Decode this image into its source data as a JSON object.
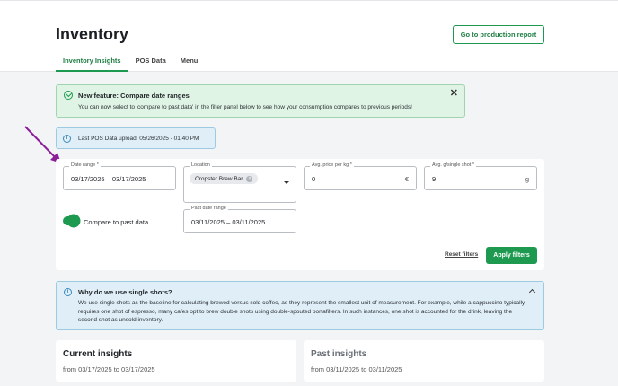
{
  "header": {
    "title": "Inventory",
    "production_report_label": "Go to production report",
    "tabs": [
      {
        "label": "Inventory Insights",
        "active": true
      },
      {
        "label": "POS Data",
        "active": false
      },
      {
        "label": "Menu",
        "active": false
      }
    ]
  },
  "banner": {
    "title": "New feature: Compare date ranges",
    "body": "You can now select to 'compare to past data' in the filter panel below to see how your consumption compares to previous periods!",
    "close_icon": "close-icon"
  },
  "upload": {
    "text": "Last POS Data upload: 05/26/2025 - 01:40 PM"
  },
  "filters": {
    "date_range": {
      "label": "Date range *",
      "value": "03/17/2025 – 03/17/2025"
    },
    "location": {
      "label": "Location",
      "chip": "Cropster Brew Bar"
    },
    "avg_price": {
      "label": "Avg. price per kg *",
      "value": "0",
      "suffix": "€"
    },
    "avg_shot": {
      "label": "Avg. g/single shot *",
      "value": "9",
      "suffix": "g"
    },
    "compare": {
      "label": "Compare to past data",
      "on": true
    },
    "past_range": {
      "label": "Past date range",
      "value": "03/11/2025 – 03/11/2025"
    },
    "reset_label": "Reset filters",
    "apply_label": "Apply filters"
  },
  "why": {
    "title": "Why do we use single shots?",
    "body": "We use single shots as the baseline for calculating brewed versus sold coffee, as they represent the smallest unit of measurement. For example, while a cappuccino typically requires one shot of espresso, many cafes opt to brew double shots using double-spouted portafilters. In such instances, one shot is accounted for the drink, leaving the second shot as unsold inventory."
  },
  "cards": {
    "current": {
      "title": "Current insights",
      "sub": "from 03/17/2025 to 03/17/2025"
    },
    "past": {
      "title": "Past insights",
      "sub": "from 03/11/2025 to 03/11/2025"
    }
  },
  "colors": {
    "accent": "#1e9a50",
    "success_bg": "#dff4e5",
    "info_bg": "#e0eff7",
    "annotation_arrow": "#8b1f9a"
  }
}
